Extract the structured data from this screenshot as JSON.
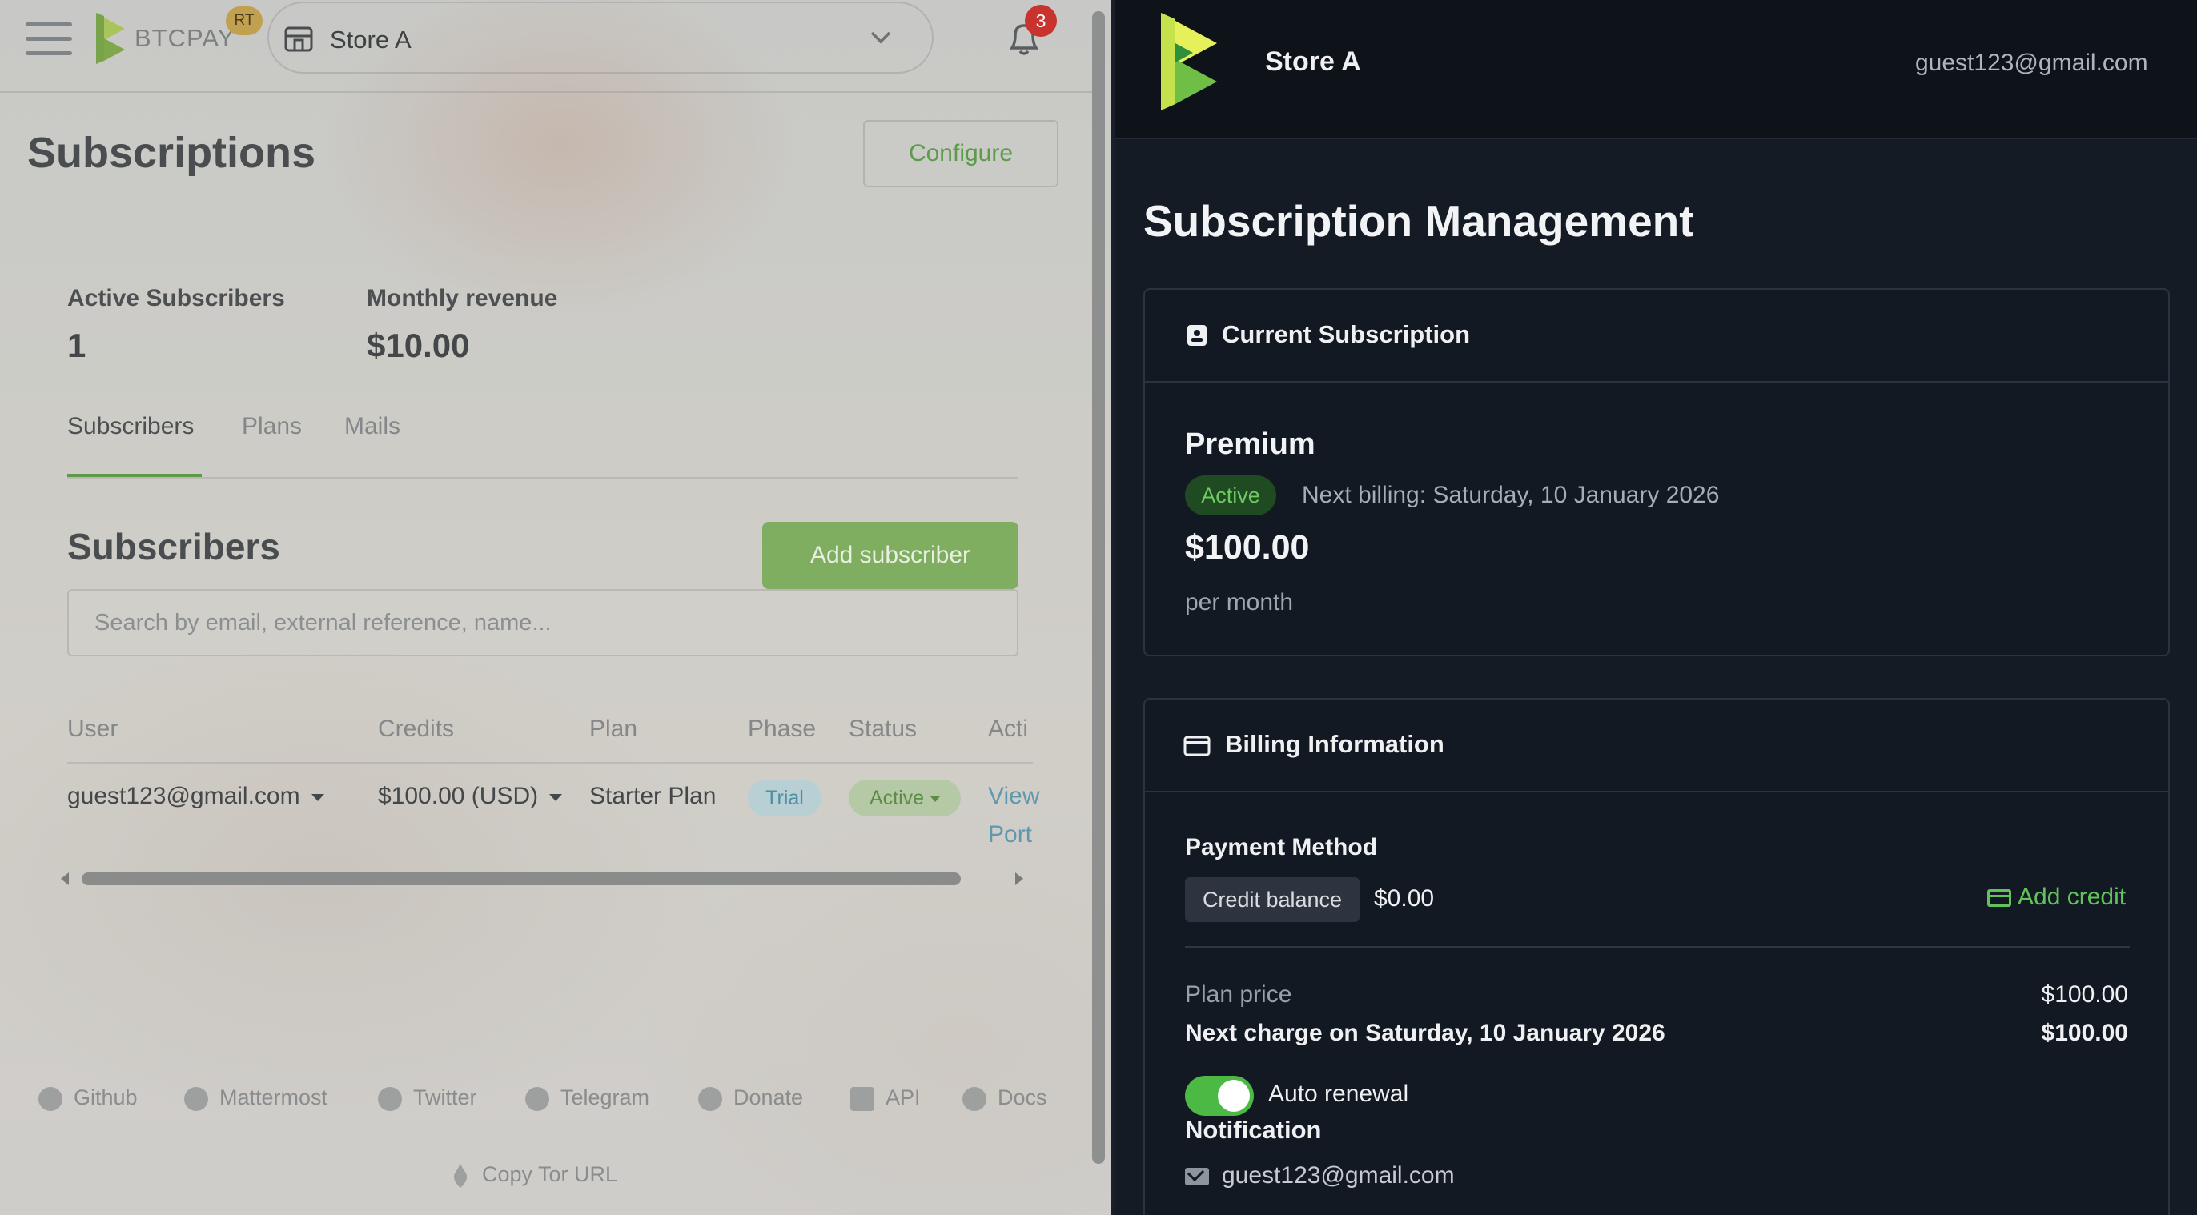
{
  "admin": {
    "brand": "BTCPAY",
    "brand_badge": "RT",
    "store_selector": "Store A",
    "notification_count": "3",
    "page_title": "Subscriptions",
    "configure_label": "Configure",
    "stats": {
      "active_label": "Active Subscribers",
      "active_value": "1",
      "revenue_label": "Monthly revenue",
      "revenue_value": "$10.00"
    },
    "tabs": [
      {
        "label": "Subscribers"
      },
      {
        "label": "Plans"
      },
      {
        "label": "Mails"
      }
    ],
    "section_title": "Subscribers",
    "add_subscriber_label": "Add subscriber",
    "search_placeholder": "Search by email, external reference, name...",
    "table": {
      "columns": [
        "User",
        "Credits",
        "Plan",
        "Phase",
        "Status",
        "Acti"
      ],
      "rows": [
        {
          "user": "guest123@gmail.com",
          "credits": "$100.00 (USD)",
          "plan": "Starter Plan",
          "phase": "Trial",
          "status": "Active",
          "action_view": "View",
          "action_portal": "Port"
        }
      ]
    },
    "footer": [
      {
        "label": "Github",
        "icon": "github-icon"
      },
      {
        "label": "Mattermost",
        "icon": "mattermost-icon"
      },
      {
        "label": "Twitter",
        "icon": "twitter-icon"
      },
      {
        "label": "Telegram",
        "icon": "telegram-icon"
      },
      {
        "label": "Donate",
        "icon": "heart-icon"
      },
      {
        "label": "API",
        "icon": "api-icon"
      },
      {
        "label": "Docs",
        "icon": "question-icon"
      }
    ],
    "tor_label": "Copy Tor URL",
    "accent": "#5d9b4b"
  },
  "portal": {
    "store_name": "Store A",
    "user_email": "guest123@gmail.com",
    "title": "Subscription Management",
    "current": {
      "header": "Current Subscription",
      "plan_name": "Premium",
      "status": "Active",
      "next_billing": "Next billing: Saturday, 10 January 2026",
      "price": "$100.00",
      "period": "per month"
    },
    "billing": {
      "header": "Billing Information",
      "payment_method_label": "Payment Method",
      "credit_badge": "Credit balance",
      "credit_value": "$0.00",
      "add_credit_label": "Add credit",
      "plan_price_label": "Plan price",
      "plan_price_value": "$100.00",
      "next_charge_label": "Next charge on Saturday, 10 January 2026",
      "next_charge_value": "$100.00",
      "auto_renewal_label": "Auto renewal",
      "notification_label": "Notification",
      "notification_email": "guest123@gmail.com"
    },
    "accent": "#4cb944"
  }
}
